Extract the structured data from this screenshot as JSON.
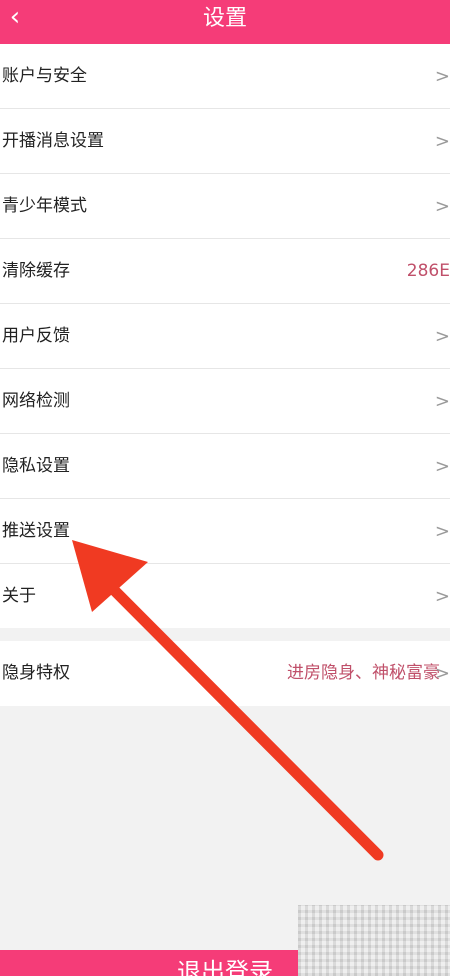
{
  "header": {
    "back_icon": "chevron-left-icon",
    "title": "设置"
  },
  "settings": {
    "items": [
      {
        "label": "账户与安全",
        "value": "",
        "chevron": ">"
      },
      {
        "label": "开播消息设置",
        "value": "",
        "chevron": ">"
      },
      {
        "label": "青少年模式",
        "value": "",
        "chevron": ">"
      },
      {
        "label": "清除缓存",
        "value": "286E",
        "chevron": ""
      },
      {
        "label": "用户反馈",
        "value": "",
        "chevron": ">"
      },
      {
        "label": "网络检测",
        "value": "",
        "chevron": ">"
      },
      {
        "label": "隐私设置",
        "value": "",
        "chevron": ">"
      },
      {
        "label": "推送设置",
        "value": "",
        "chevron": ">"
      },
      {
        "label": "关于",
        "value": "",
        "chevron": ">"
      }
    ],
    "special": {
      "label": "隐身特权",
      "value": "进房隐身、神秘富豪",
      "chevron": ">"
    }
  },
  "logout": {
    "label": "退出登录"
  },
  "colors": {
    "accent": "#f53c78",
    "value_text": "#c0506a",
    "annotation_arrow": "#f03a22"
  }
}
